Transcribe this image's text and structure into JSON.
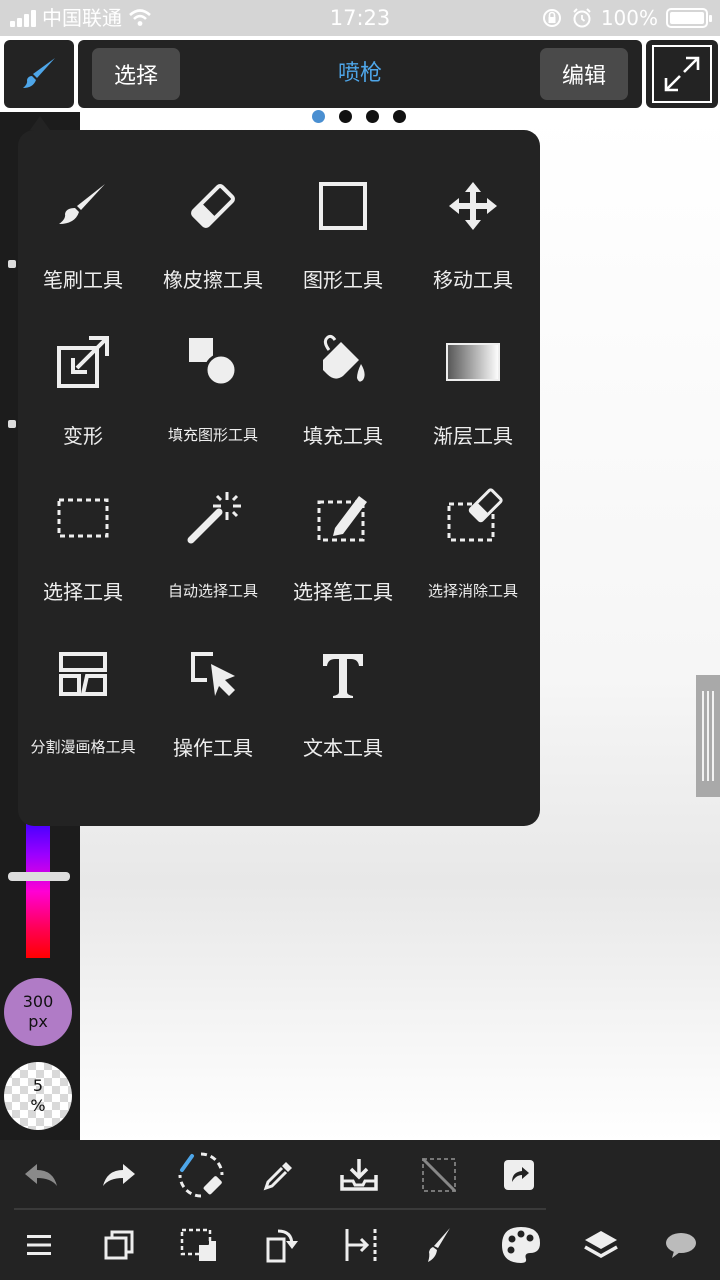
{
  "status_bar": {
    "carrier": "中国联通",
    "time": "17:23",
    "battery": "100%"
  },
  "top_bar": {
    "select_label": "选择",
    "tool_name": "喷枪",
    "edit_label": "编辑"
  },
  "page_indicator": {
    "count": 4,
    "active": 0
  },
  "tools": [
    {
      "label": "笔刷工具",
      "icon": "brush-icon"
    },
    {
      "label": "橡皮擦工具",
      "icon": "eraser-icon"
    },
    {
      "label": "图形工具",
      "icon": "square-shape-icon"
    },
    {
      "label": "移动工具",
      "icon": "move-arrows-icon"
    },
    {
      "label": "变形",
      "icon": "transform-icon"
    },
    {
      "label": "填充图形工具",
      "icon": "fill-shape-icon"
    },
    {
      "label": "填充工具",
      "icon": "paint-bucket-icon"
    },
    {
      "label": "渐层工具",
      "icon": "gradient-icon"
    },
    {
      "label": "选择工具",
      "icon": "select-rect-icon"
    },
    {
      "label": "自动选择工具",
      "icon": "magic-wand-icon"
    },
    {
      "label": "选择笔工具",
      "icon": "select-pen-icon"
    },
    {
      "label": "选择消除工具",
      "icon": "select-eraser-icon"
    },
    {
      "label": "分割漫画格工具",
      "icon": "panel-divide-icon"
    },
    {
      "label": "操作工具",
      "icon": "operation-cursor-icon"
    },
    {
      "label": "文本工具",
      "icon": "text-icon"
    }
  ],
  "sidebar": {
    "brush_size_value": "300",
    "brush_size_unit": "px",
    "opacity_value": "5",
    "opacity_unit": "%",
    "colors": {
      "panel": "#232323",
      "accent": "#4ea6e9",
      "size_circle": "#b07bc6"
    }
  },
  "bottom_toolbar_1": [
    "undo-icon",
    "redo-icon",
    "brush-eraser-swap-icon",
    "eyedropper-icon",
    "save-icon",
    "clear-selection-icon",
    "share-icon"
  ],
  "bottom_toolbar_2": [
    "menu-icon",
    "layers-copy-icon",
    "selection-icon",
    "rotate-icon",
    "ruler-icon",
    "brush-icon",
    "palette-icon",
    "layers-icon",
    "speech-bubble-icon"
  ]
}
